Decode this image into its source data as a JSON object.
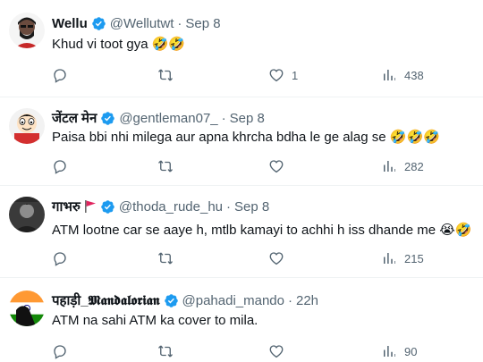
{
  "tweets": [
    {
      "name": "Wellu",
      "handle": "@Wellutwt",
      "separator": "·",
      "time": "Sep 8",
      "text": "Khud vi toot gya",
      "text_emoji": "🤣🤣",
      "avatar_icon": "man-with-beard-avatar",
      "actions": {
        "replies": "",
        "retweets": "",
        "likes": "1",
        "views": "438"
      }
    },
    {
      "name": "जेंटल मेन",
      "handle": "@gentleman07_",
      "separator": "·",
      "time": "Sep 8",
      "text": "Paisa bbi nhi milega aur apna khrcha bdha le ge alag se",
      "text_emoji": "🤣🤣🤣",
      "avatar_icon": "cartoon-boy-avatar",
      "actions": {
        "replies": "",
        "retweets": "",
        "likes": "",
        "views": "282"
      }
    },
    {
      "name": "गाभरु",
      "handle": "@thoda_rude_hu",
      "separator": "·",
      "time": "Sep 8",
      "text": "ATM lootne car se aaye h, mtlb kamayi to achhi h iss dhande me",
      "text_emoji": "😭🤣",
      "avatar_icon": "dark-portrait-avatar",
      "flag_icon": "red-flag-icon",
      "actions": {
        "replies": "",
        "retweets": "",
        "likes": "",
        "views": "215"
      }
    },
    {
      "name": "पहाड़ी_𝕸𝖆𝖓𝖉𝖆𝖑𝖔𝖗𝖎𝖆𝖓",
      "handle": "@pahadi_mando",
      "separator": "·",
      "time": "22h",
      "text": "ATM na sahi ATM ka cover to mila.",
      "text_emoji": "",
      "avatar_icon": "india-flag-silhouette-avatar",
      "actions": {
        "replies": "",
        "retweets": "",
        "likes": "",
        "views": "90"
      }
    }
  ],
  "colors": {
    "verified": "#1d9bf0",
    "secondary_text": "#536471",
    "divider": "#eff3f4"
  }
}
